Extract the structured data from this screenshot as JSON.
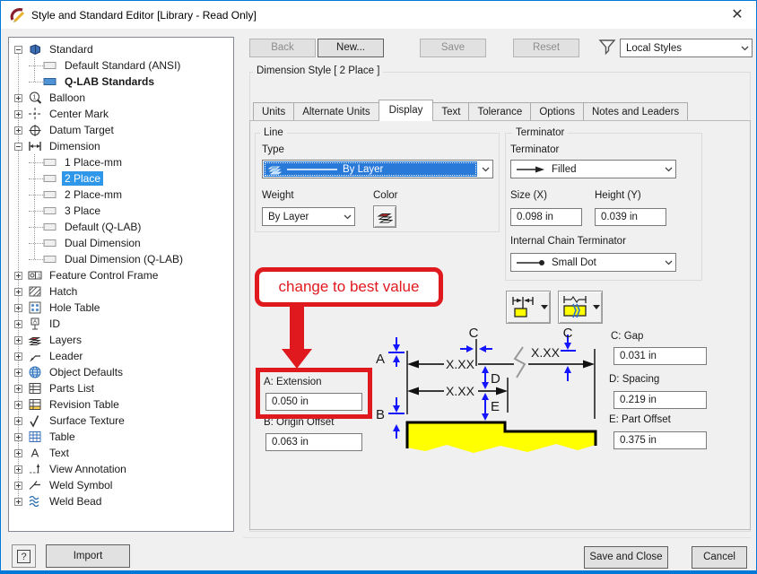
{
  "window": {
    "title": "Style and Standard Editor [Library - Read Only]",
    "close_glyph": "✕"
  },
  "toolbar": {
    "back_label": "Back",
    "new_label": "New...",
    "save_label": "Save",
    "reset_label": "Reset",
    "filter_value": "Local Styles"
  },
  "group_title": "Dimension Style [ 2 Place ]",
  "tabs": {
    "labels": [
      "Units",
      "Alternate Units",
      "Display",
      "Text",
      "Tolerance",
      "Options",
      "Notes and Leaders"
    ],
    "active_index": 2
  },
  "tree": {
    "items": [
      {
        "label": "Standard",
        "depth": 0,
        "expander": "minus",
        "icon": "book-icon"
      },
      {
        "label": "Default Standard (ANSI)",
        "depth": 1,
        "icon": "swatch-icon"
      },
      {
        "label": "Q-LAB Standards",
        "depth": 1,
        "icon": "swatch-blue-icon",
        "bold": true
      },
      {
        "label": "Balloon",
        "depth": 0,
        "expander": "plus",
        "icon": "balloon-icon"
      },
      {
        "label": "Center Mark",
        "depth": 0,
        "expander": "plus",
        "icon": "center-mark-icon"
      },
      {
        "label": "Datum Target",
        "depth": 0,
        "expander": "plus",
        "icon": "datum-target-icon"
      },
      {
        "label": "Dimension",
        "depth": 0,
        "expander": "minus",
        "icon": "dimension-icon"
      },
      {
        "label": "1 Place-mm",
        "depth": 1,
        "icon": "swatch-icon"
      },
      {
        "label": "2 Place",
        "depth": 1,
        "icon": "swatch-icon",
        "selected": true
      },
      {
        "label": "2 Place-mm",
        "depth": 1,
        "icon": "swatch-icon"
      },
      {
        "label": "3 Place",
        "depth": 1,
        "icon": "swatch-icon"
      },
      {
        "label": "Default (Q-LAB)",
        "depth": 1,
        "icon": "swatch-icon"
      },
      {
        "label": "Dual Dimension",
        "depth": 1,
        "icon": "swatch-icon"
      },
      {
        "label": "Dual Dimension (Q-LAB)",
        "depth": 1,
        "icon": "swatch-icon"
      },
      {
        "label": "Feature Control Frame",
        "depth": 0,
        "expander": "plus",
        "icon": "fcf-icon"
      },
      {
        "label": "Hatch",
        "depth": 0,
        "expander": "plus",
        "icon": "hatch-icon"
      },
      {
        "label": "Hole Table",
        "depth": 0,
        "expander": "plus",
        "icon": "hole-table-icon"
      },
      {
        "label": "ID",
        "depth": 0,
        "expander": "plus",
        "icon": "id-icon"
      },
      {
        "label": "Layers",
        "depth": 0,
        "expander": "plus",
        "icon": "layers-icon"
      },
      {
        "label": "Leader",
        "depth": 0,
        "expander": "plus",
        "icon": "leader-icon"
      },
      {
        "label": "Object Defaults",
        "depth": 0,
        "expander": "plus",
        "icon": "object-defaults-icon"
      },
      {
        "label": "Parts List",
        "depth": 0,
        "expander": "plus",
        "icon": "parts-list-icon"
      },
      {
        "label": "Revision Table",
        "depth": 0,
        "expander": "plus",
        "icon": "revision-table-icon"
      },
      {
        "label": "Surface Texture",
        "depth": 0,
        "expander": "plus",
        "icon": "surface-texture-icon"
      },
      {
        "label": "Table",
        "depth": 0,
        "expander": "plus",
        "icon": "table-icon"
      },
      {
        "label": "Text",
        "depth": 0,
        "expander": "plus",
        "icon": "text-icon"
      },
      {
        "label": "View Annotation",
        "depth": 0,
        "expander": "plus",
        "icon": "view-annotation-icon"
      },
      {
        "label": "Weld Symbol",
        "depth": 0,
        "expander": "plus",
        "icon": "weld-symbol-icon"
      },
      {
        "label": "Weld Bead",
        "depth": 0,
        "expander": "plus",
        "icon": "weld-bead-icon"
      }
    ]
  },
  "line_group": {
    "title": "Line",
    "type_label": "Type",
    "type_value": "By Layer",
    "weight_label": "Weight",
    "weight_value": "By Layer",
    "color_label": "Color"
  },
  "terminator_group": {
    "title": "Terminator",
    "terminator_label": "Terminator",
    "terminator_value": "Filled",
    "size_label": "Size (X)",
    "size_value": "0.098 in",
    "height_label": "Height (Y)",
    "height_value": "0.039 in",
    "chain_label": "Internal Chain Terminator",
    "chain_value": "Small Dot"
  },
  "annotation": {
    "text": "change to best value"
  },
  "fields": {
    "a_label": "A: Extension",
    "a_value": "0.050 in",
    "b_label": "B: Origin Offset",
    "b_value": "0.063 in",
    "c_label": "C: Gap",
    "c_value": "0.031 in",
    "d_label": "D: Spacing",
    "d_value": "0.219 in",
    "e_label": "E: Part Offset",
    "e_value": "0.375 in"
  },
  "diagram": {
    "dim_text_1": "X.XX",
    "dim_text_2": "X.XX",
    "dim_text_3": "X.XX",
    "letter_a": "A",
    "letter_b": "B",
    "letter_c1": "C",
    "letter_c2": "C",
    "letter_d": "D",
    "letter_e": "E"
  },
  "footer": {
    "help_glyph": "?",
    "import_label": "Import",
    "save_close_label": "Save and Close",
    "cancel_label": "Cancel"
  },
  "colors": {
    "accent": "#0078d7",
    "selection_blue": "#2f97ea",
    "combo_selection_blue": "#2979d9",
    "annotation_red": "#e0191f",
    "part_yellow": "#ffff00",
    "diagram_blue": "#1414ff"
  }
}
